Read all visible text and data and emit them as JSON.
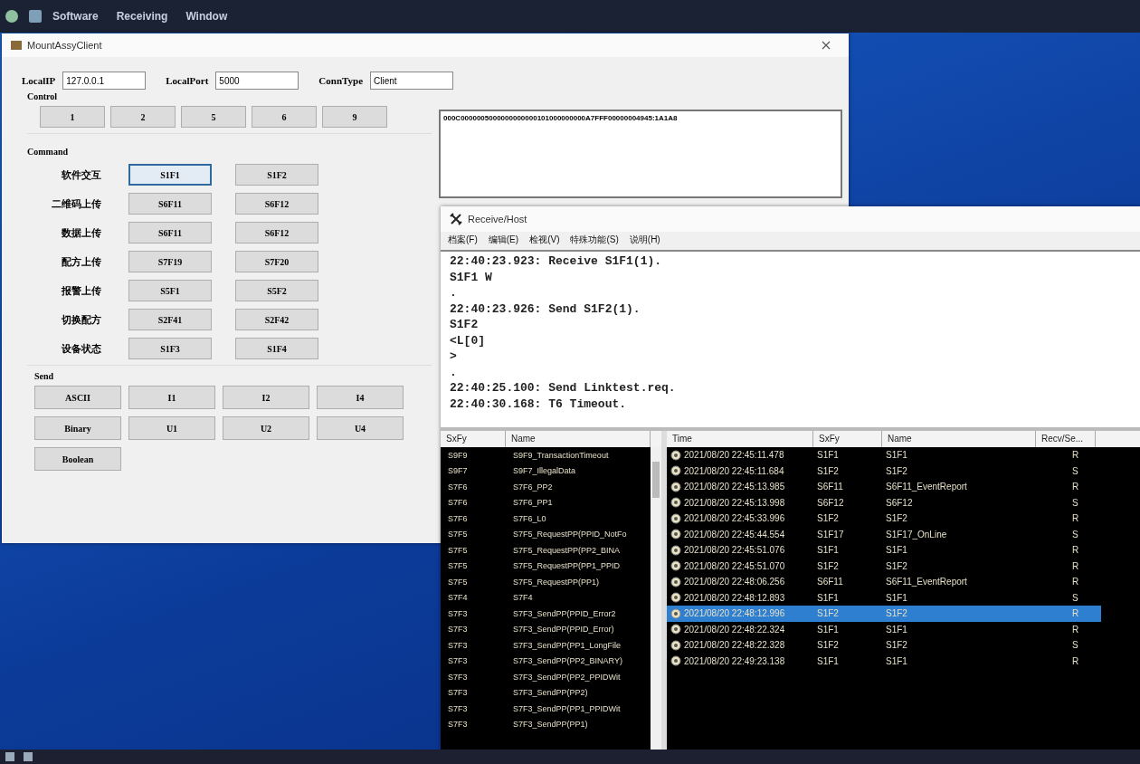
{
  "top_bar": {
    "menu": [
      "Software",
      "Receiving",
      "Window"
    ]
  },
  "client_window": {
    "title": "MountAssyClient",
    "fields": [
      {
        "label": "LocalIP",
        "value": "127.0.0.1"
      },
      {
        "label": "LocalPort",
        "value": "5000"
      },
      {
        "label": "ConnType",
        "value": "Client"
      }
    ],
    "control": {
      "title": "Control",
      "buttons": [
        "1",
        "2",
        "5",
        "6",
        "9"
      ]
    },
    "command": {
      "title": "Command",
      "rows": [
        {
          "label": "软件交互",
          "buttons": [
            {
              "label": "S1F1",
              "focused": true
            },
            {
              "label": "S1F2",
              "focused": false
            }
          ]
        },
        {
          "label": "二维码上传",
          "buttons": [
            {
              "label": "S6F11",
              "focused": false
            },
            {
              "label": "S6F12",
              "focused": false
            }
          ]
        },
        {
          "label": "数据上传",
          "buttons": [
            {
              "label": "S6F11",
              "focused": false
            },
            {
              "label": "S6F12",
              "focused": false
            }
          ]
        },
        {
          "label": "配方上传",
          "buttons": [
            {
              "label": "S7F19",
              "focused": false
            },
            {
              "label": "S7F20",
              "focused": false
            }
          ]
        },
        {
          "label": "报警上传",
          "buttons": [
            {
              "label": "S5F1",
              "focused": false
            },
            {
              "label": "S5F2",
              "focused": false
            }
          ]
        },
        {
          "label": "切换配方",
          "buttons": [
            {
              "label": "S2F41",
              "focused": false
            },
            {
              "label": "S2F42",
              "focused": false
            }
          ]
        },
        {
          "label": "设备状态",
          "buttons": [
            {
              "label": "S1F3",
              "focused": false
            },
            {
              "label": "S1F4",
              "focused": false
            }
          ]
        }
      ]
    },
    "send": {
      "title": "Send",
      "buttons": [
        "ASCII",
        "I1",
        "I2",
        "I4",
        "Binary",
        "U1",
        "U2",
        "U4",
        "Boolean"
      ]
    },
    "message_box": {
      "value": "000C0000005000000000000101000000000A7FFF00000004945:1A1A8"
    }
  },
  "host_window": {
    "title": "Receive/Host",
    "menu": [
      "档案(F)",
      "编辑(E)",
      "检视(V)",
      "特殊功能(S)",
      "说明(H)"
    ],
    "log": [
      "22:40:23.923: Receive S1F1(1).",
      "S1F1 W",
      ".",
      "22:40:23.926: Send S1F2(1).",
      "S1F2",
      "<L[0]",
      ">",
      ".",
      "22:40:25.100: Send Linktest.req.",
      "22:40:30.168: T6 Timeout."
    ],
    "message_list": {
      "columns": [
        "SxFy",
        "Name"
      ],
      "rows": [
        [
          "S9F9",
          "S9F9_TransactionTimeout"
        ],
        [
          "S9F7",
          "S9F7_IllegalData"
        ],
        [
          "S7F6",
          "S7F6_PP2"
        ],
        [
          "S7F6",
          "S7F6_PP1"
        ],
        [
          "S7F6",
          "S7F6_L0"
        ],
        [
          "S7F5",
          "S7F5_RequestPP(PPID_NotFo"
        ],
        [
          "S7F5",
          "S7F5_RequestPP(PP2_BINA"
        ],
        [
          "S7F5",
          "S7F5_RequestPP(PP1_PPID"
        ],
        [
          "S7F5",
          "S7F5_RequestPP(PP1)"
        ],
        [
          "S7F4",
          "S7F4"
        ],
        [
          "S7F3",
          "S7F3_SendPP(PPID_Error2"
        ],
        [
          "S7F3",
          "S7F3_SendPP(PPID_Error)"
        ],
        [
          "S7F3",
          "S7F3_SendPP(PP1_LongFile"
        ],
        [
          "S7F3",
          "S7F3_SendPP(PP2_BINARY)"
        ],
        [
          "S7F3",
          "S7F3_SendPP(PP2_PPIDWit"
        ],
        [
          "S7F3",
          "S7F3_SendPP(PP2)"
        ],
        [
          "S7F3",
          "S7F3_SendPP(PP1_PPIDWit"
        ],
        [
          "S7F3",
          "S7F3_SendPP(PP1)"
        ]
      ]
    },
    "history": {
      "columns": [
        "Time",
        "SxFy",
        "Name",
        "Recv/Se..."
      ],
      "rows": [
        {
          "time": "2021/08/20 22:45:11.478",
          "sxfy": "S1F1",
          "name": "S1F1",
          "direction": "R",
          "selected": false
        },
        {
          "time": "2021/08/20 22:45:11.684",
          "sxfy": "S1F2",
          "name": "S1F2",
          "direction": "S",
          "selected": false
        },
        {
          "time": "2021/08/20 22:45:13.985",
          "sxfy": "S6F11",
          "name": "S6F11_EventReport",
          "direction": "R",
          "selected": false
        },
        {
          "time": "2021/08/20 22:45:13.998",
          "sxfy": "S6F12",
          "name": "S6F12",
          "direction": "S",
          "selected": false
        },
        {
          "time": "2021/08/20 22:45:33.996",
          "sxfy": "S1F2",
          "name": "S1F2",
          "direction": "R",
          "selected": false
        },
        {
          "time": "2021/08/20 22:45:44.554",
          "sxfy": "S1F17",
          "name": "S1F17_OnLine",
          "direction": "S",
          "selected": false
        },
        {
          "time": "2021/08/20 22:45:51.076",
          "sxfy": "S1F1",
          "name": "S1F1",
          "direction": "R",
          "selected": false
        },
        {
          "time": "2021/08/20 22:45:51.070",
          "sxfy": "S1F2",
          "name": "S1F2",
          "direction": "R",
          "selected": false
        },
        {
          "time": "2021/08/20 22:48:06.256",
          "sxfy": "S6F11",
          "name": "S6F11_EventReport",
          "direction": "R",
          "selected": false
        },
        {
          "time": "2021/08/20 22:48:12.893",
          "sxfy": "S1F1",
          "name": "S1F1",
          "direction": "S",
          "selected": false
        },
        {
          "time": "2021/08/20 22:48:12.996",
          "sxfy": "S1F2",
          "name": "S1F2",
          "direction": "R",
          "selected": true
        },
        {
          "time": "2021/08/20 22:48:22.324",
          "sxfy": "S1F1",
          "name": "S1F1",
          "direction": "R",
          "selected": false
        },
        {
          "time": "2021/08/20 22:48:22.328",
          "sxfy": "S1F2",
          "name": "S1F2",
          "direction": "S",
          "selected": false
        },
        {
          "time": "2021/08/20 22:49:23.138",
          "sxfy": "S1F1",
          "name": "S1F1",
          "direction": "R",
          "selected": false
        }
      ]
    }
  }
}
